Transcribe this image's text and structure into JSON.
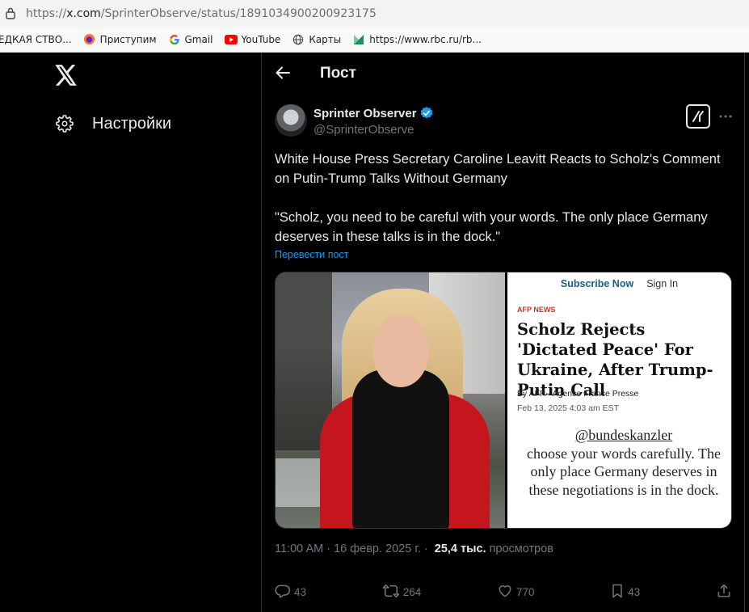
{
  "browser": {
    "url_prefix": "https://",
    "url_domain": "x.com",
    "url_path": "/SprinterObserve/status/1891034900200923175",
    "bookmarks": [
      {
        "label": "ЕДКАЯ СТВО...",
        "icon": "page-icon"
      },
      {
        "label": "Приступим",
        "icon": "firefox-icon"
      },
      {
        "label": "Gmail",
        "icon": "google-icon"
      },
      {
        "label": "YouTube",
        "icon": "youtube-icon"
      },
      {
        "label": "Карты",
        "icon": "globe-icon"
      },
      {
        "label": "https://www.rbc.ru/rb...",
        "icon": "rbc-icon"
      }
    ]
  },
  "sidebar": {
    "settings_label": "Настройки"
  },
  "header": {
    "title": "Пост"
  },
  "post": {
    "author_name": "Sprinter Observer",
    "author_handle": "@SprinterObserve",
    "text_line1": "White House Press Secretary Caroline Leavitt Reacts to Scholz's Comment on Putin-Trump Talks Without Germany",
    "text_line2": "\"Scholz, you need to be careful with your words. The only place Germany deserves in these talks is in the dock.\"",
    "translate_label": "Перевести пост",
    "article": {
      "subscribe": "Subscribe Now",
      "signin": "Sign In",
      "source": "AFP NEWS",
      "headline": "Scholz Rejects 'Dictated Peace' For Ukraine, After Trump-Putin Call",
      "byline": "By AFP - Agence France Presse",
      "date": "Feb 13, 2025 4:03 am EST",
      "quote_handle": "@bundeskanzler",
      "quote_rest": "choose your words carefully. The only place Germany deserves in these negotiations is in the dock."
    },
    "timestamp": "11:00 AM · 16 февр. 2025 г. ·",
    "views_count": "25,4 тыс.",
    "views_label": "просмотров",
    "replies": "43",
    "reposts": "264",
    "likes": "770",
    "bookmarks": "43"
  },
  "colors": {
    "accent": "#1d9bf0",
    "muted": "#71767b",
    "text": "#e7e9ea",
    "background": "#000000"
  }
}
